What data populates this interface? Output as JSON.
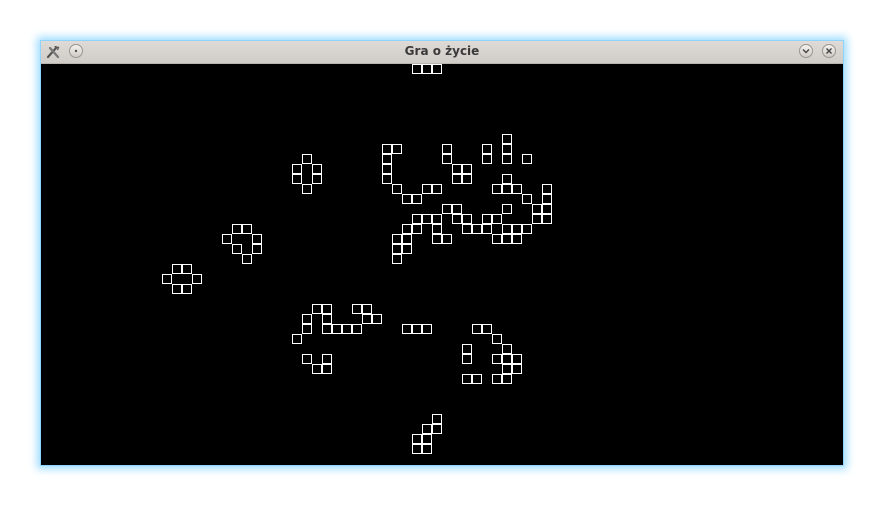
{
  "window": {
    "title": "Gra o życie"
  },
  "icons": {
    "app": "tools-icon",
    "menu": "window-menu-icon",
    "minimize": "minimize-icon",
    "close": "close-icon"
  },
  "colors": {
    "board_background": "#000000",
    "cell_border": "#ffffff"
  },
  "board": {
    "live_cells": [
      [
        37,
        0
      ],
      [
        38,
        0
      ],
      [
        39,
        0
      ],
      [
        46,
        7
      ],
      [
        46,
        8
      ],
      [
        46,
        9
      ],
      [
        44,
        8
      ],
      [
        44,
        9
      ],
      [
        40,
        8
      ],
      [
        40,
        9
      ],
      [
        34,
        8
      ],
      [
        34,
        9
      ],
      [
        34,
        10
      ],
      [
        34,
        11
      ],
      [
        35,
        8
      ],
      [
        48,
        9
      ],
      [
        26,
        9
      ],
      [
        25,
        10
      ],
      [
        27,
        10
      ],
      [
        25,
        11
      ],
      [
        27,
        11
      ],
      [
        26,
        12
      ],
      [
        41,
        10
      ],
      [
        42,
        10
      ],
      [
        41,
        11
      ],
      [
        42,
        11
      ],
      [
        35,
        12
      ],
      [
        36,
        13
      ],
      [
        37,
        13
      ],
      [
        38,
        12
      ],
      [
        39,
        12
      ],
      [
        46,
        11
      ],
      [
        45,
        12
      ],
      [
        47,
        12
      ],
      [
        50,
        12
      ],
      [
        48,
        13
      ],
      [
        50,
        13
      ],
      [
        49,
        14
      ],
      [
        50,
        14
      ],
      [
        49,
        15
      ],
      [
        50,
        15
      ],
      [
        46,
        12
      ],
      [
        46,
        14
      ],
      [
        40,
        14
      ],
      [
        41,
        14
      ],
      [
        39,
        15
      ],
      [
        41,
        15
      ],
      [
        42,
        15
      ],
      [
        44,
        15
      ],
      [
        45,
        15
      ],
      [
        37,
        15
      ],
      [
        38,
        15
      ],
      [
        36,
        16
      ],
      [
        37,
        16
      ],
      [
        39,
        16
      ],
      [
        42,
        16
      ],
      [
        43,
        16
      ],
      [
        44,
        16
      ],
      [
        46,
        16
      ],
      [
        47,
        16
      ],
      [
        48,
        16
      ],
      [
        35,
        17
      ],
      [
        36,
        17
      ],
      [
        39,
        17
      ],
      [
        40,
        17
      ],
      [
        45,
        17
      ],
      [
        46,
        17
      ],
      [
        47,
        17
      ],
      [
        35,
        18
      ],
      [
        36,
        18
      ],
      [
        35,
        19
      ],
      [
        19,
        16
      ],
      [
        20,
        16
      ],
      [
        18,
        17
      ],
      [
        21,
        17
      ],
      [
        19,
        18
      ],
      [
        21,
        18
      ],
      [
        20,
        19
      ],
      [
        13,
        20
      ],
      [
        14,
        20
      ],
      [
        12,
        21
      ],
      [
        15,
        21
      ],
      [
        13,
        22
      ],
      [
        14,
        22
      ],
      [
        27,
        24
      ],
      [
        28,
        24
      ],
      [
        31,
        24
      ],
      [
        32,
        24
      ],
      [
        26,
        25
      ],
      [
        28,
        25
      ],
      [
        32,
        25
      ],
      [
        33,
        25
      ],
      [
        26,
        26
      ],
      [
        28,
        26
      ],
      [
        29,
        26
      ],
      [
        30,
        26
      ],
      [
        31,
        26
      ],
      [
        25,
        27
      ],
      [
        36,
        26
      ],
      [
        37,
        26
      ],
      [
        38,
        26
      ],
      [
        43,
        26
      ],
      [
        44,
        26
      ],
      [
        45,
        27
      ],
      [
        42,
        28
      ],
      [
        46,
        28
      ],
      [
        42,
        29
      ],
      [
        45,
        29
      ],
      [
        46,
        29
      ],
      [
        47,
        29
      ],
      [
        46,
        30
      ],
      [
        47,
        30
      ],
      [
        26,
        29
      ],
      [
        28,
        29
      ],
      [
        27,
        30
      ],
      [
        28,
        30
      ],
      [
        42,
        31
      ],
      [
        43,
        31
      ],
      [
        45,
        31
      ],
      [
        46,
        31
      ],
      [
        39,
        35
      ],
      [
        38,
        36
      ],
      [
        39,
        36
      ],
      [
        37,
        37
      ],
      [
        38,
        37
      ],
      [
        37,
        38
      ],
      [
        38,
        38
      ]
    ]
  }
}
